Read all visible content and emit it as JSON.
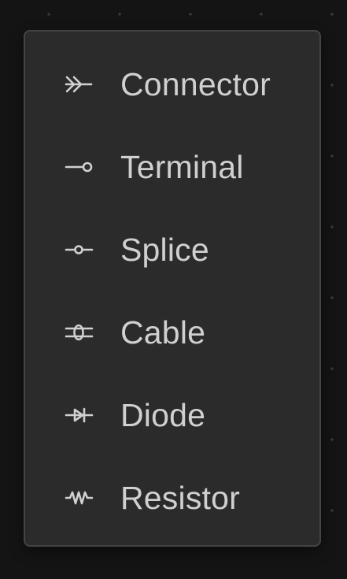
{
  "menu": {
    "items": [
      {
        "label": "Connector",
        "icon": "connector-icon"
      },
      {
        "label": "Terminal",
        "icon": "terminal-icon"
      },
      {
        "label": "Splice",
        "icon": "splice-icon"
      },
      {
        "label": "Cable",
        "icon": "cable-icon"
      },
      {
        "label": "Diode",
        "icon": "diode-icon"
      },
      {
        "label": "Resistor",
        "icon": "resistor-icon"
      }
    ]
  },
  "colors": {
    "canvas_background": "#141414",
    "canvas_dots": "#3a3a3a",
    "menu_background": "#2b2b2b",
    "menu_border": "#444444",
    "text": "#d0d0d0",
    "icon": "#d0d0d0"
  }
}
